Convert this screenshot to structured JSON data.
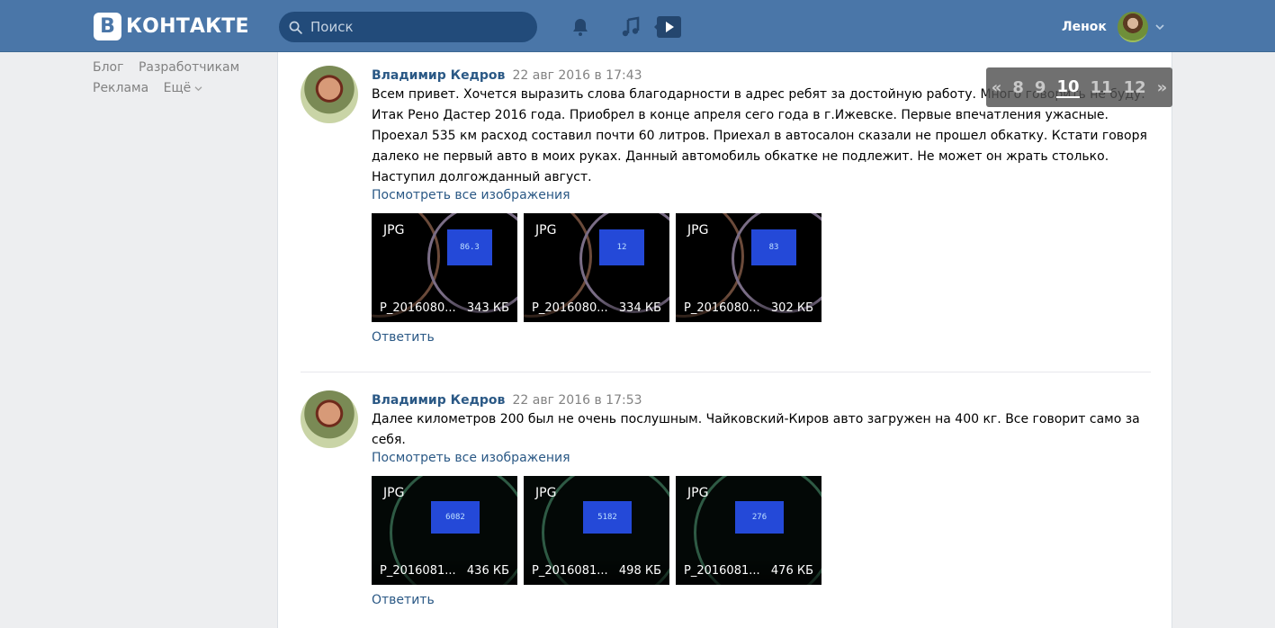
{
  "header": {
    "logo_letter": "В",
    "logo_text": "КОНТАКТЕ",
    "search_placeholder": "Поиск",
    "user_name": "Ленок",
    "icons": [
      "search-icon",
      "bell-icon",
      "music-icon",
      "play-icon",
      "chevron-down-icon"
    ]
  },
  "left_links": {
    "blog": "Блог",
    "developers": "Разработчикам",
    "ads": "Реклама",
    "more": "Ещё"
  },
  "pager": {
    "prev": "«",
    "pages": [
      "8",
      "9",
      "10",
      "11",
      "12"
    ],
    "current": "10",
    "next": "»"
  },
  "posts": [
    {
      "author": "Владимир Кедров",
      "date": "22 авг 2016 в 17:43",
      "text": "Всем привет. Хочется выразить слова благодарности в адрес ребят за достойную работу. Много говорить не буду. Итак Рено Дастер 2016 года. Приобрел в конце апреля сего года в г.Ижевске. Первые впечатления ужасные. Проехал 535 км расход составил почти 60 литров. Приехал в автосалон сказали не прошел обкатку. Кстати говоря далеко не первый авто в моих руках. Данный автомобиль обкатке не подлежит. Не может он жрать столько. Наступил долгожданный август.",
      "see_all": "Посмотреть все изображения",
      "reply": "Ответить",
      "attachments": [
        {
          "type": "JPG",
          "name": "P_2016080...",
          "size": "343 КБ",
          "screen": "86.3"
        },
        {
          "type": "JPG",
          "name": "P_2016080...",
          "size": "334 КБ",
          "screen": "12"
        },
        {
          "type": "JPG",
          "name": "P_2016080...",
          "size": "302 КБ",
          "screen": "83"
        }
      ]
    },
    {
      "author": "Владимир Кедров",
      "date": "22 авг 2016 в 17:53",
      "text": "Далее километров 200 был не очень послушным. Чайковский-Киров авто загружен на 400 кг. Все говорит само за себя.",
      "see_all": "Посмотреть все изображения",
      "reply": "Ответить",
      "attachments": [
        {
          "type": "JPG",
          "name": "P_2016081...",
          "size": "436 КБ",
          "screen": "6082"
        },
        {
          "type": "JPG",
          "name": "P_2016081...",
          "size": "498 КБ",
          "screen": "5182"
        },
        {
          "type": "JPG",
          "name": "P_2016081...",
          "size": "476 КБ",
          "screen": "276"
        }
      ]
    }
  ]
}
